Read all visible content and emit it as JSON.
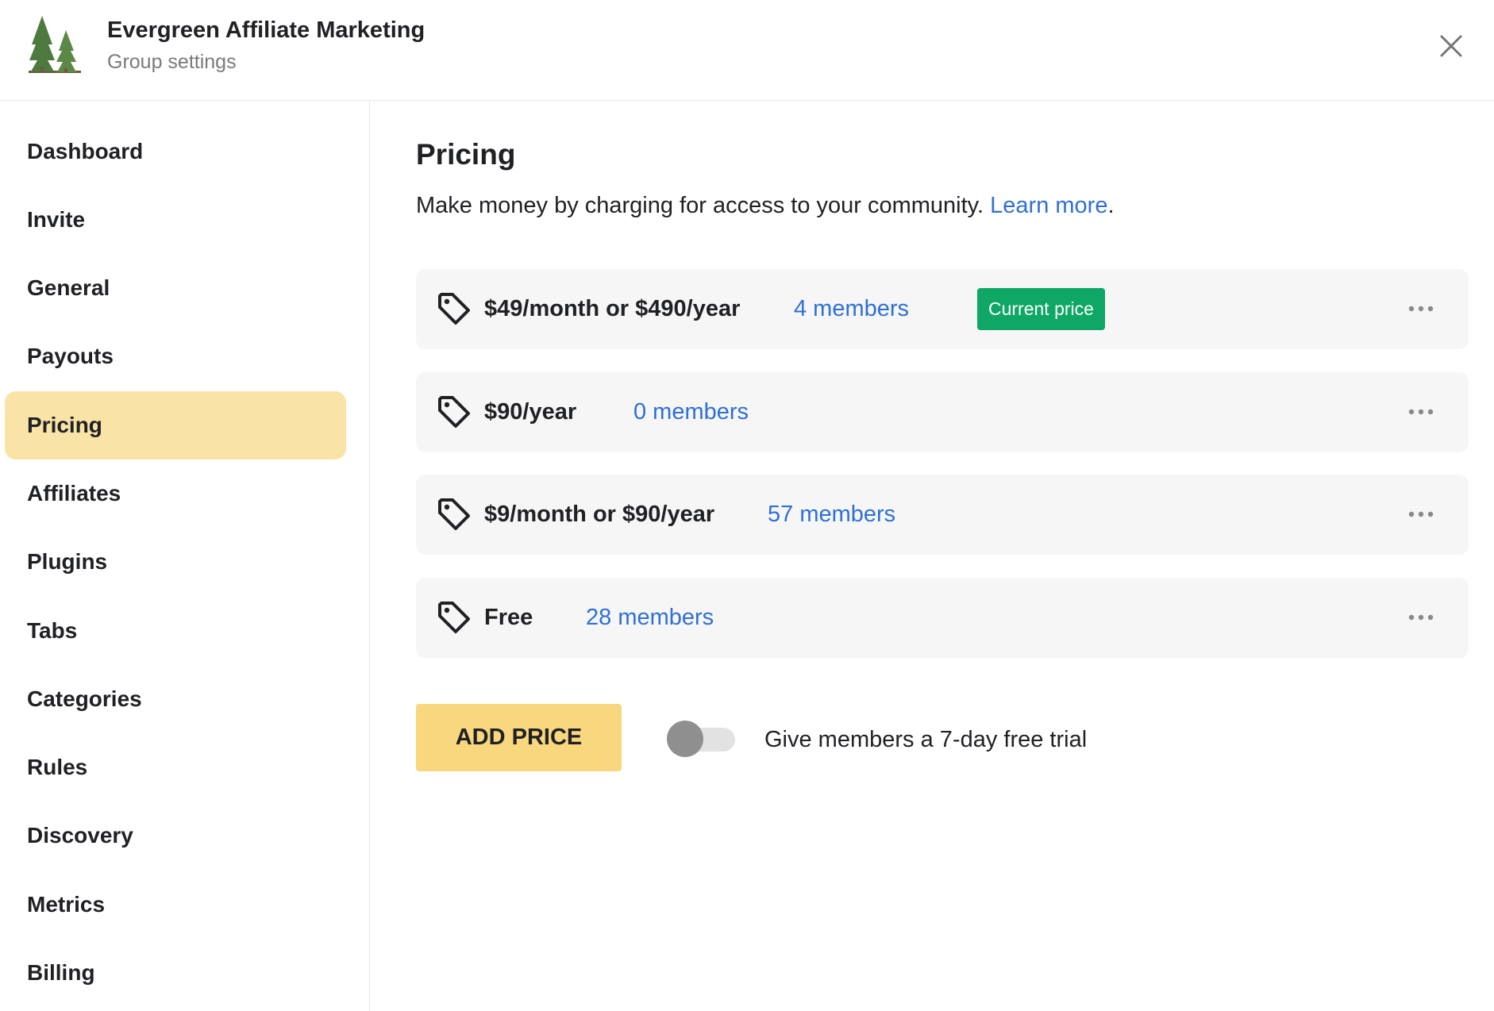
{
  "header": {
    "title": "Evergreen Affiliate Marketing",
    "subtitle": "Group settings"
  },
  "sidebar": {
    "items": [
      {
        "label": "Dashboard"
      },
      {
        "label": "Invite"
      },
      {
        "label": "General"
      },
      {
        "label": "Payouts"
      },
      {
        "label": "Pricing",
        "active": true
      },
      {
        "label": "Affiliates"
      },
      {
        "label": "Plugins"
      },
      {
        "label": "Tabs"
      },
      {
        "label": "Categories"
      },
      {
        "label": "Rules"
      },
      {
        "label": "Discovery"
      },
      {
        "label": "Metrics"
      },
      {
        "label": "Billing"
      }
    ]
  },
  "main": {
    "title": "Pricing",
    "description": "Make money by charging for access to your community.",
    "learn_more": "Learn more",
    "learn_more_suffix": ".",
    "prices": [
      {
        "label": "$49/month or $490/year",
        "members": "4 members",
        "badge": "Current price"
      },
      {
        "label": "$90/year",
        "members": "0 members"
      },
      {
        "label": "$9/month or $90/year",
        "members": "57 members"
      },
      {
        "label": "Free",
        "members": "28 members"
      }
    ],
    "add_price_label": "ADD PRICE",
    "trial_toggle": {
      "label": "Give members a 7-day free trial",
      "enabled": false
    }
  },
  "colors": {
    "accent_link": "#2f6fd6",
    "active_nav": "#f9e3a6",
    "badge_green": "#0ea765",
    "add_button": "#f9d77e"
  },
  "icons": [
    "trees-logo-icon",
    "close-icon",
    "price-tag-icon",
    "more-horizontal-icon"
  ]
}
